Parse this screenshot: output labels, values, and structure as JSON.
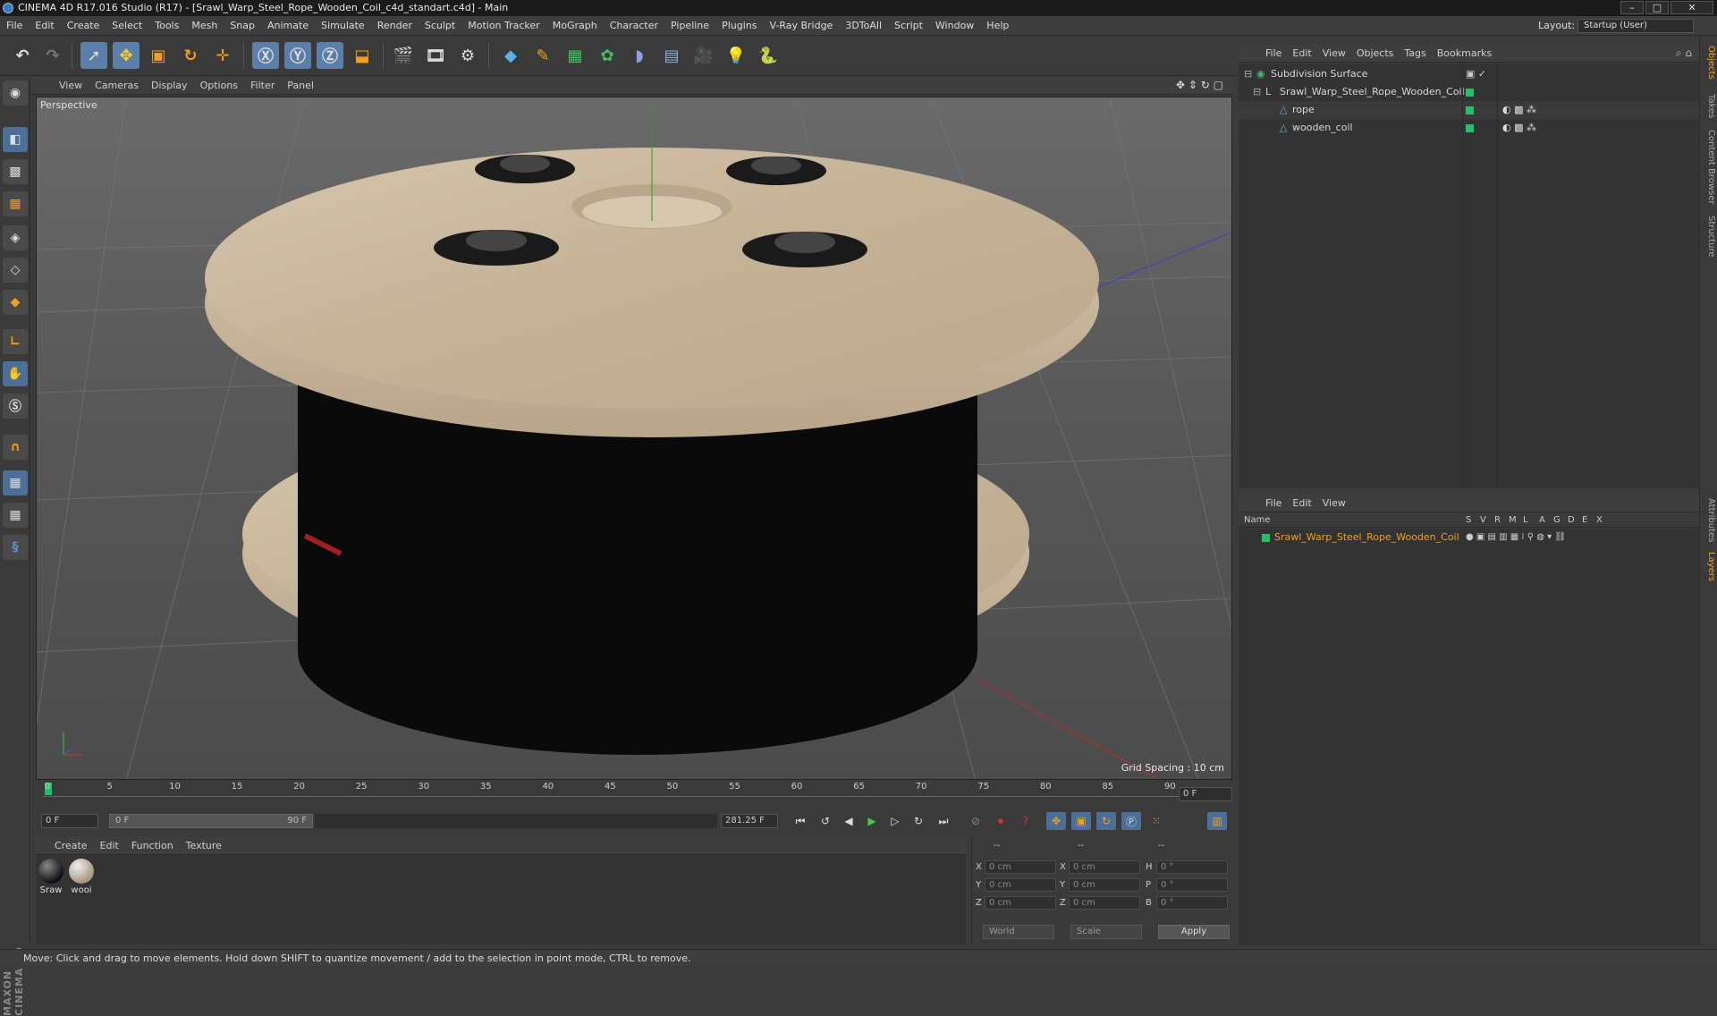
{
  "window": {
    "title": "CINEMA 4D R17.016 Studio (R17) - [Srawl_Warp_Steel_Rope_Wooden_Coil_c4d_standart.c4d] - Main",
    "controls": [
      "–",
      "□",
      "✕"
    ]
  },
  "menubar": {
    "items": [
      "File",
      "Edit",
      "Create",
      "Select",
      "Tools",
      "Mesh",
      "Snap",
      "Animate",
      "Simulate",
      "Render",
      "Sculpt",
      "Motion Tracker",
      "MoGraph",
      "Character",
      "Pipeline",
      "Plugins",
      "V-Ray Bridge",
      "3DToAll",
      "Script",
      "Window",
      "Help"
    ],
    "layout_label": "Layout:",
    "layout_value": "Startup (User)"
  },
  "viewport": {
    "menu": [
      "View",
      "Cameras",
      "Display",
      "Options",
      "Filter",
      "Panel"
    ],
    "camera_label": "Perspective",
    "grid_spacing": "Grid Spacing : 10 cm"
  },
  "timeline": {
    "ticks": [
      "0",
      "5",
      "10",
      "15",
      "20",
      "25",
      "30",
      "35",
      "40",
      "45",
      "50",
      "55",
      "60",
      "65",
      "70",
      "75",
      "80",
      "85",
      "90"
    ],
    "current_frame": "0 F",
    "start_field": "0 F",
    "range_start": "0 F",
    "range_end": "90 F",
    "fps_field": "281.25 F"
  },
  "material_manager": {
    "menu": [
      "Create",
      "Edit",
      "Function",
      "Texture"
    ],
    "materials": [
      {
        "label": "Sraw",
        "color": "#222222"
      },
      {
        "label": "wooi",
        "color": "#c8b8a0"
      }
    ]
  },
  "coordinates": {
    "header": [
      "--",
      "--",
      "--"
    ],
    "rows": [
      {
        "a": "X",
        "av": "0 cm",
        "b": "X",
        "bv": "0 cm",
        "c": "H",
        "cv": "0 °"
      },
      {
        "a": "Y",
        "av": "0 cm",
        "b": "Y",
        "bv": "0 cm",
        "c": "P",
        "cv": "0 °"
      },
      {
        "a": "Z",
        "av": "0 cm",
        "b": "Z",
        "bv": "0 cm",
        "c": "B",
        "cv": "0 °"
      }
    ],
    "world": "World",
    "scale": "Scale",
    "apply": "Apply"
  },
  "object_manager": {
    "menu": [
      "File",
      "Edit",
      "View",
      "Objects",
      "Tags",
      "Bookmarks"
    ],
    "objects": [
      {
        "name": "Subdivision Surface"
      },
      {
        "name": "Srawl_Warp_Steel_Rope_Wooden_Coil"
      },
      {
        "name": "rope"
      },
      {
        "name": "wooden_coil"
      }
    ]
  },
  "layer_manager": {
    "menu": [
      "File",
      "Edit",
      "View"
    ],
    "columns": [
      "Name",
      "S",
      "V",
      "R",
      "M",
      "L",
      "A",
      "G",
      "D",
      "E",
      "X"
    ],
    "layer_name": "Srawl_Warp_Steel_Rope_Wooden_Coil"
  },
  "right_tabs": [
    "Objects",
    "Takes",
    "Content Browser",
    "Structure",
    "Attributes",
    "Layers"
  ],
  "logo": "MAXON CINEMA 4D",
  "status": "Move: Click and drag to move elements. Hold down SHIFT to quantize movement / add to the selection in point mode, CTRL to remove.",
  "colors": {
    "accent": "#5b7fa8",
    "object_green": "#23c06a",
    "layer_orange": "#f0a020"
  }
}
